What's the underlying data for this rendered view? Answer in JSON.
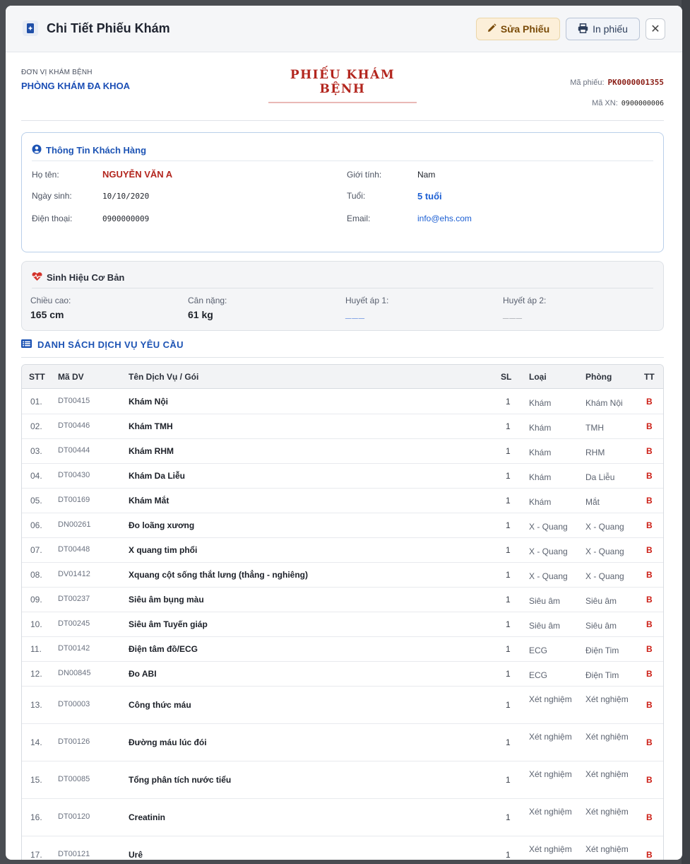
{
  "header": {
    "title": "Chi Tiết Phiếu Khám",
    "edit_label": "Sửa Phiếu",
    "print_label": "In phiếu",
    "close_glyph": "✕"
  },
  "doc": {
    "unit_caption": "ĐƠN VỊ KHÁM BỆNH",
    "unit_name": "PHÒNG KHÁM ĐA KHOA",
    "title": "PHIẾU KHÁM BỆNH",
    "ma_phieu_label": "Mã phiếu:",
    "ma_phieu": "PK0000001355",
    "ma_xn_label": "Mã XN:",
    "ma_xn": "0900000006"
  },
  "customer": {
    "title": "Thông Tin Khách Hàng",
    "name_label": "Họ tên:",
    "name": "NGUYỄN VĂN A",
    "gender_label": "Giới tính:",
    "gender": "Nam",
    "dob_label": "Ngày sinh:",
    "dob": "10/10/2020",
    "age_label": "Tuổi:",
    "age": "5 tuổi",
    "phone_label": "Điện thoại:",
    "phone": "0900000009",
    "email_label": "Email:",
    "email": "info@ehs.com"
  },
  "vitals": {
    "title": "Sinh Hiệu Cơ Bản",
    "height_label": "Chiều cao:",
    "height": "165 cm",
    "weight_label": "Cân nặng:",
    "weight": "61 kg",
    "bp1_label": "Huyết áp 1:",
    "bp1": "___",
    "bp2_label": "Huyết áp 2:",
    "bp2": "___"
  },
  "services": {
    "title": "DANH SÁCH DỊCH VỤ YÊU CẦU",
    "columns": [
      "STT",
      "Mã DV",
      "Tên Dịch Vụ / Gói",
      "SL",
      "Loại",
      "Phòng",
      "TT"
    ],
    "rows": [
      {
        "stt": "01.",
        "ma": "DT00415",
        "ten": "Khám Nội",
        "sl": "1",
        "loai": "Khám",
        "phong": "Khám Nội",
        "tt": "B"
      },
      {
        "stt": "02.",
        "ma": "DT00446",
        "ten": "Khám TMH",
        "sl": "1",
        "loai": "Khám",
        "phong": "TMH",
        "tt": "B"
      },
      {
        "stt": "03.",
        "ma": "DT00444",
        "ten": "Khám RHM",
        "sl": "1",
        "loai": "Khám",
        "phong": "RHM",
        "tt": "B"
      },
      {
        "stt": "04.",
        "ma": "DT00430",
        "ten": "Khám Da Liễu",
        "sl": "1",
        "loai": "Khám",
        "phong": "Da Liễu",
        "tt": "B"
      },
      {
        "stt": "05.",
        "ma": "DT00169",
        "ten": "Khám Mắt",
        "sl": "1",
        "loai": "Khám",
        "phong": "Mắt",
        "tt": "B"
      },
      {
        "stt": "06.",
        "ma": "DN00261",
        "ten": "Đo loãng xương",
        "sl": "1",
        "loai": "X - Quang",
        "phong": "X - Quang",
        "tt": "B"
      },
      {
        "stt": "07.",
        "ma": "DT00448",
        "ten": "X quang tim phổi",
        "sl": "1",
        "loai": "X - Quang",
        "phong": "X - Quang",
        "tt": "B"
      },
      {
        "stt": "08.",
        "ma": "DV01412",
        "ten": "Xquang cột sống thắt lưng (thẳng - nghiêng)",
        "sl": "1",
        "loai": "X - Quang",
        "phong": "X - Quang",
        "tt": "B"
      },
      {
        "stt": "09.",
        "ma": "DT00237",
        "ten": "Siêu âm bụng màu",
        "sl": "1",
        "loai": "Siêu âm",
        "phong": "Siêu âm",
        "tt": "B"
      },
      {
        "stt": "10.",
        "ma": "DT00245",
        "ten": "Siêu âm Tuyến giáp",
        "sl": "1",
        "loai": "Siêu âm",
        "phong": "Siêu âm",
        "tt": "B"
      },
      {
        "stt": "11.",
        "ma": "DT00142",
        "ten": "Điện tâm đồ/ECG",
        "sl": "1",
        "loai": "ECG",
        "phong": "Điện Tim",
        "tt": "B"
      },
      {
        "stt": "12.",
        "ma": "DN00845",
        "ten": "Đo ABI",
        "sl": "1",
        "loai": "ECG",
        "phong": "Điện Tim",
        "tt": "B"
      },
      {
        "stt": "13.",
        "ma": "DT00003",
        "ten": "Công thức máu",
        "sl": "1",
        "loai": "Xét nghiệm",
        "phong": "Xét nghiệm",
        "tt": "B"
      },
      {
        "stt": "14.",
        "ma": "DT00126",
        "ten": "Đường máu lúc đói",
        "sl": "1",
        "loai": "Xét nghiệm",
        "phong": "Xét nghiệm",
        "tt": "B"
      },
      {
        "stt": "15.",
        "ma": "DT00085",
        "ten": "Tổng phân tích nước tiểu",
        "sl": "1",
        "loai": "Xét nghiệm",
        "phong": "Xét nghiệm",
        "tt": "B"
      },
      {
        "stt": "16.",
        "ma": "DT00120",
        "ten": "Creatinin",
        "sl": "1",
        "loai": "Xét nghiệm",
        "phong": "Xét nghiệm",
        "tt": "B"
      },
      {
        "stt": "17.",
        "ma": "DT00121",
        "ten": "Urê",
        "sl": "1",
        "loai": "Xét nghiệm",
        "phong": "Xét nghiệm",
        "tt": "B"
      }
    ]
  },
  "colors": {
    "accent_blue": "#1c53b4",
    "title_red": "#b3261e",
    "tt_red": "#cc1d14",
    "dash_blue": "#3b6fd8",
    "dash_gray": "#8a8f98"
  }
}
